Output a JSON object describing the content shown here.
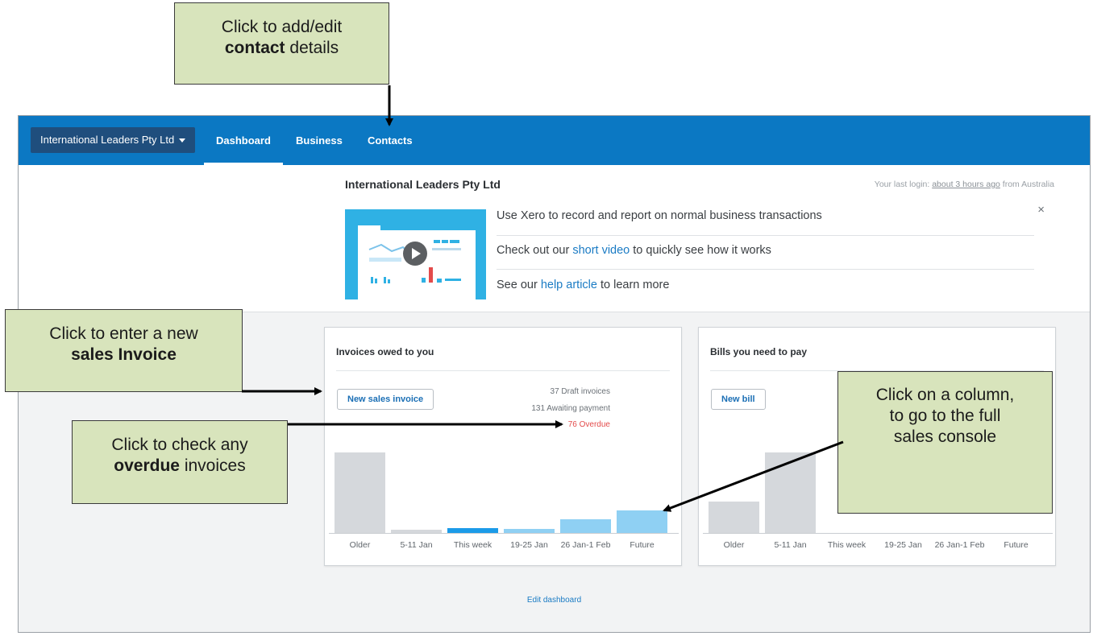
{
  "topbar": {
    "org_selector": "International Leaders Pty Ltd",
    "tabs": [
      "Dashboard",
      "Business",
      "Contacts"
    ]
  },
  "welcome": {
    "org_name": "International Leaders Pty Ltd",
    "last_login_prefix": "Your last login:",
    "last_login_link": "about 3 hours ago",
    "last_login_suffix": "from Australia",
    "close": "×",
    "line1": "Use Xero to record and report on normal business transactions",
    "line2_pre": "Check out our",
    "line2_link": "short video",
    "line2_post": "to quickly see how it works",
    "line3_pre": "See our",
    "line3_link": "help article",
    "line3_post": "to learn more"
  },
  "invoices_card": {
    "title": "Invoices owed to you",
    "button": "New sales invoice",
    "stats": [
      "37 Draft invoices",
      "131 Awaiting payment",
      "76 Overdue"
    ]
  },
  "bills_card": {
    "title": "Bills you need to pay",
    "button": "New bill"
  },
  "edit_dashboard": "Edit dashboard",
  "callouts": {
    "contact_1": "Click to add/edit",
    "contact_bold": "contact",
    "contact_2": "details",
    "invoice_1": "Click to enter a new",
    "invoice_bold": "sales Invoice",
    "overdue_1": "Click to check any",
    "overdue_bold": "overdue",
    "overdue_2": "invoices",
    "column_1": "Click on a column,",
    "column_2": "to go to the full",
    "column_3": "sales console"
  },
  "colors": {
    "topbar": "#0b78c3",
    "bar_grey": "#d5d8dc",
    "bar_blue": "#1b9be8",
    "bar_lightblue": "#8fd0f3",
    "overdue": "#e34b4b",
    "callout": "#d8e4bc"
  },
  "chart_data": [
    {
      "type": "bar",
      "title": "Invoices owed to you",
      "categories": [
        "Older",
        "5-11 Jan",
        "This week",
        "19-25 Jan",
        "26 Jan-1 Feb",
        "Future"
      ],
      "values": [
        100,
        4,
        6,
        5,
        17,
        28
      ]
    },
    {
      "type": "bar",
      "title": "Bills you need to pay",
      "categories": [
        "Older",
        "5-11 Jan",
        "This week",
        "19-25 Jan",
        "26 Jan-1 Feb",
        "Future"
      ],
      "values": [
        39,
        100,
        0,
        0,
        0,
        0
      ]
    }
  ]
}
